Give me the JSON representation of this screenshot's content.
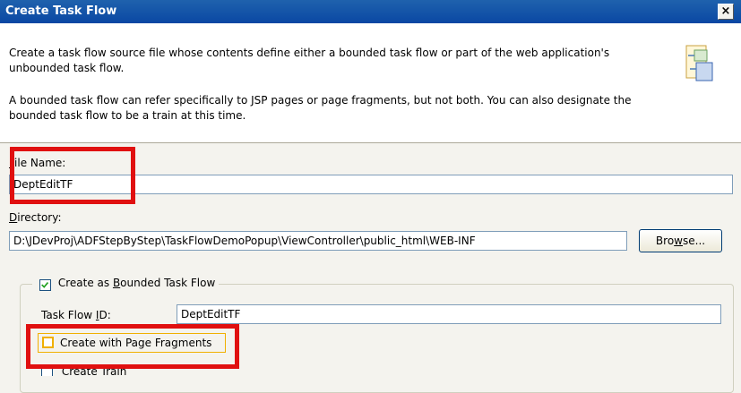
{
  "dialog": {
    "title": "Create Task Flow",
    "close_glyph": "×",
    "description_1": "Create a task flow source file whose contents define either a bounded task flow or part of the web application's unbounded task flow.",
    "description_2": "A bounded task flow can refer specifically to JSP pages or page fragments, but not both.  You can also designate the bounded task flow to be a train at this time.",
    "icon": "task-flow-wizard-icon"
  },
  "file_name": {
    "label_mnemonic": "F",
    "label_rest": "ile Name:",
    "value": "DeptEditTF"
  },
  "directory": {
    "label_mnemonic": "D",
    "label_rest": "irectory:",
    "value": "D:\\JDevProj\\ADFStepByStep\\TaskFlowDemoPopup\\ViewController\\public_html\\WEB-INF",
    "browse_label_mnemonic": "w",
    "browse_label_pre": "Bro",
    "browse_label_post": "se..."
  },
  "bounded": {
    "checked": true,
    "label_pre": "Create as ",
    "label_mnemonic": "B",
    "label_post": "ounded Task Flow",
    "task_flow_id_label_pre": "Task Flow ",
    "task_flow_id_label_mnemonic": "I",
    "task_flow_id_label_post": "D:",
    "task_flow_id_value": "DeptEditTF",
    "page_fragments_checked": false,
    "page_fragments_label": "Create with Page Fragments",
    "create_train_label": "Create Train"
  },
  "colors": {
    "titlebar": "#0a47a3",
    "highlight": "#e01010",
    "checkbox_focus": "#f0b000"
  }
}
